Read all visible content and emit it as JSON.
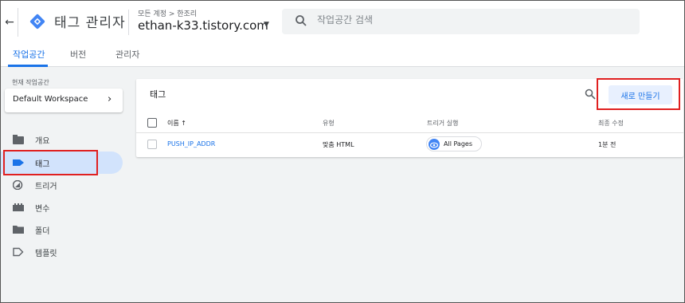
{
  "header": {
    "app_title": "태그 관리자",
    "breadcrumb": "모든 계정 > 한조리",
    "account_name": "ethan-k33.tistory.com",
    "search_placeholder": "작업공간 검색"
  },
  "tabs": [
    {
      "label": "작업공간",
      "active": true
    },
    {
      "label": "버전",
      "active": false
    },
    {
      "label": "관리자",
      "active": false
    }
  ],
  "workspace": {
    "label": "현재 작업공간",
    "name": "Default Workspace"
  },
  "sidebar": {
    "items": [
      {
        "label": "개요",
        "icon": "overview-icon",
        "active": false
      },
      {
        "label": "태그",
        "icon": "tag-icon",
        "active": true
      },
      {
        "label": "트리거",
        "icon": "trigger-icon",
        "active": false
      },
      {
        "label": "변수",
        "icon": "variable-icon",
        "active": false
      },
      {
        "label": "폴더",
        "icon": "folder-icon",
        "active": false
      },
      {
        "label": "템플릿",
        "icon": "template-icon",
        "active": false
      }
    ]
  },
  "card": {
    "title": "태그",
    "new_button": "새로 만들기",
    "columns": {
      "name": "이름 ↑",
      "type": "유형",
      "trigger": "트리거 실행",
      "modified": "최종 수정"
    },
    "rows": [
      {
        "name": "PUSH_IP_ADDR",
        "type": "맞춤 HTML",
        "trigger": "All Pages",
        "modified": "1분 전"
      }
    ]
  },
  "colors": {
    "accent": "#1a73e8",
    "active_nav_bg": "#d2e3fc",
    "highlight": "#e02020"
  }
}
